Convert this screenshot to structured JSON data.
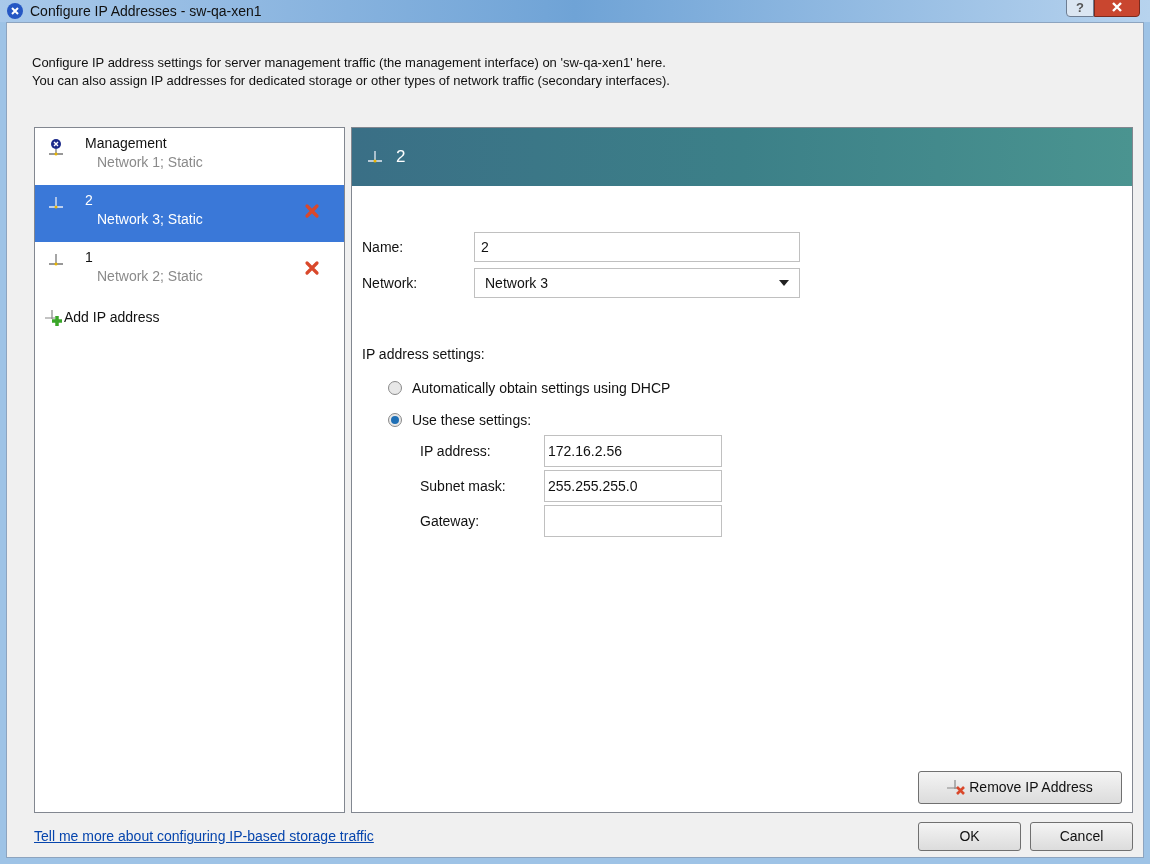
{
  "window": {
    "title": "Configure IP Addresses - sw-qa-xen1",
    "help": "?"
  },
  "description": [
    "Configure IP address settings for server management traffic (the management interface) on 'sw-qa-xen1' here.",
    "You can also assign IP addresses for dedicated storage or other types of network traffic (secondary interfaces)."
  ],
  "interfaces": [
    {
      "kind": "management",
      "name": "Management",
      "detail": "Network 1; Static",
      "selected": false,
      "removable": false
    },
    {
      "kind": "secondary",
      "name": "2",
      "detail": "Network 3; Static",
      "selected": true,
      "removable": true
    },
    {
      "kind": "secondary",
      "name": "1",
      "detail": "Network 2; Static",
      "selected": false,
      "removable": true
    }
  ],
  "add_link": "Add IP address",
  "detail": {
    "header": "2",
    "name_label": "Name:",
    "name_value": "2",
    "network_label": "Network:",
    "network_value": "Network 3",
    "section_label": "IP address settings:",
    "options": [
      {
        "label": "Automatically obtain settings using DHCP",
        "selected": false
      },
      {
        "label": "Use these settings:",
        "selected": true
      }
    ],
    "fields": [
      {
        "label": "IP address:",
        "value": "172.16.2.56"
      },
      {
        "label": "Subnet mask:",
        "value": "255.255.255.0"
      },
      {
        "label": "Gateway:"
      }
    ],
    "remove_button": "Remove IP Address"
  },
  "help_link": "Tell me more about configuring IP-based storage traffic",
  "buttons": [
    "OK",
    "Cancel"
  ]
}
